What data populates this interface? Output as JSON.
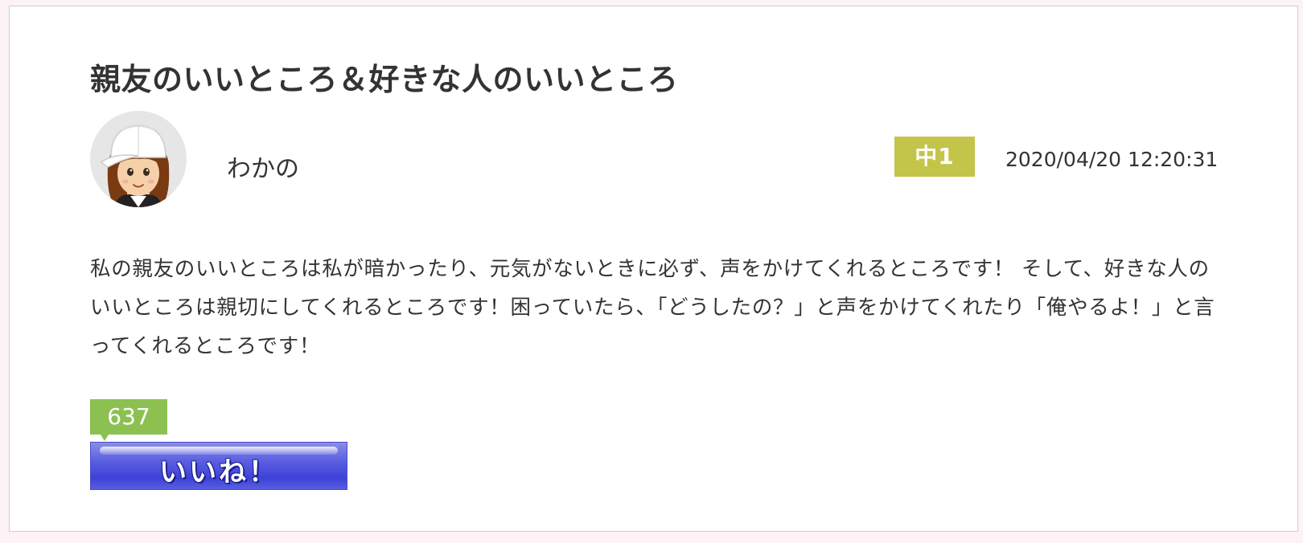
{
  "post": {
    "title": "親友のいいところ＆好きな人のいいところ",
    "author": "わかの",
    "grade": "中1",
    "date": "2020/04/20 12:20:31",
    "body": "私の親友のいいところは私が暗かったり、元気がないときに必ず、声をかけてくれるところです！ そして、好きな人のいいところは親切にしてくれるところです！困っていたら、「どうしたの？」と声をかけてくれたり「俺やるよ！」と言ってくれるところです！"
  },
  "like": {
    "count": "637",
    "button_label": "いいね！"
  },
  "colors": {
    "grade_badge": "#c3c44a",
    "like_count_badge": "#8cc152",
    "like_button": "#5b5fe0"
  },
  "icons": {
    "avatar": "girl-with-white-cap-avatar"
  }
}
